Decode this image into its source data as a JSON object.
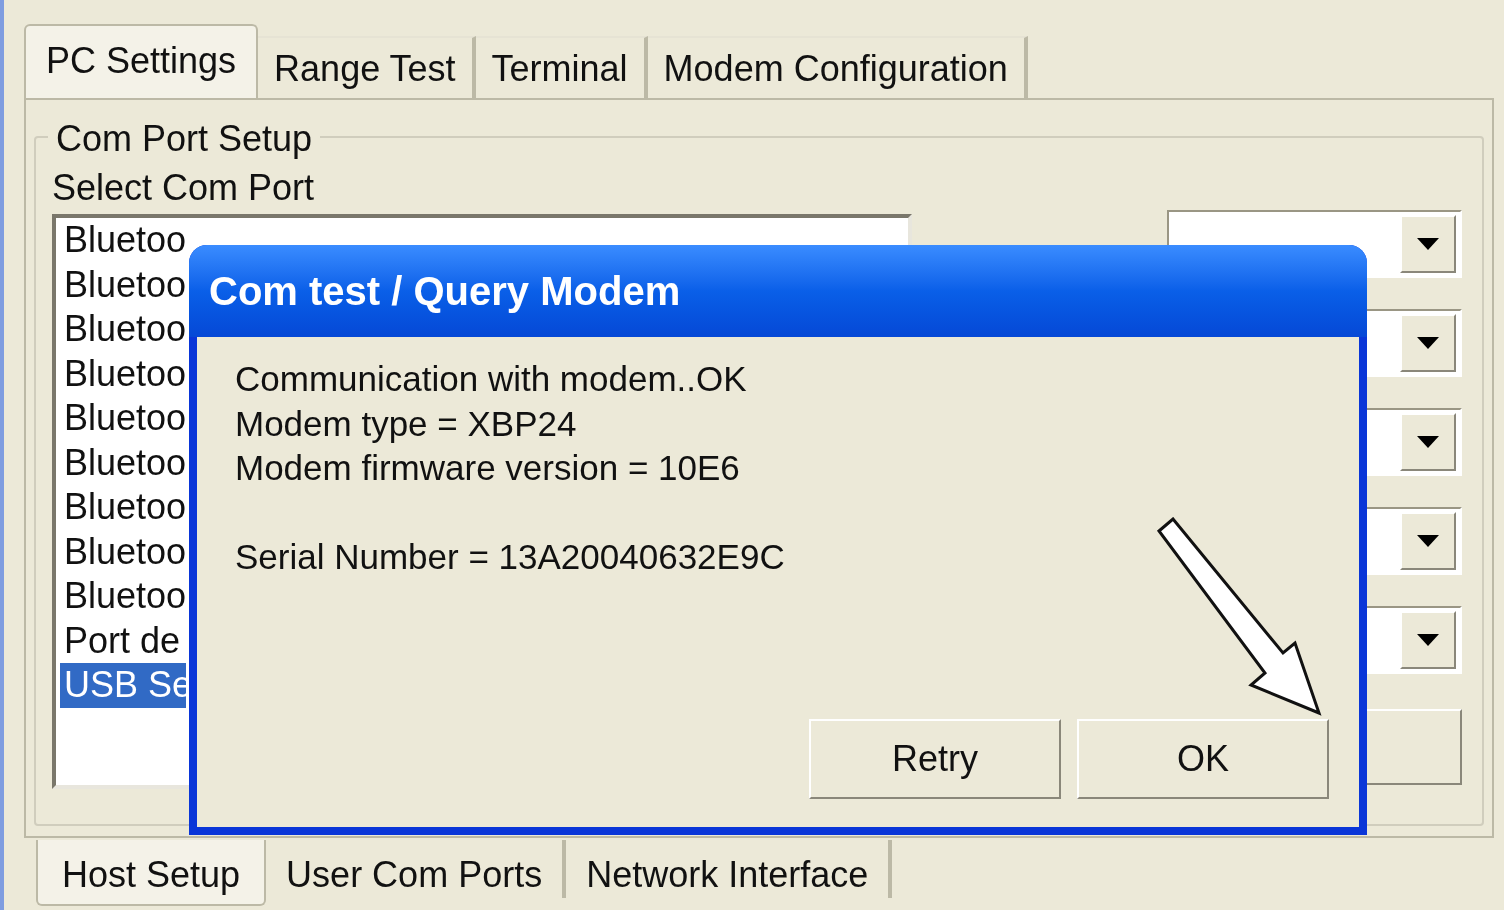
{
  "tabs": [
    {
      "label": "PC Settings",
      "selected": true
    },
    {
      "label": "Range Test",
      "selected": false
    },
    {
      "label": "Terminal",
      "selected": false
    },
    {
      "label": "Modem Configuration",
      "selected": false
    }
  ],
  "com_port_setup": {
    "title": "Com Port Setup",
    "label": "Select Com Port",
    "ports": [
      {
        "text": "Bluetoo",
        "selected": false
      },
      {
        "text": "Bluetoo",
        "selected": false
      },
      {
        "text": "Bluetoo",
        "selected": false
      },
      {
        "text": "Bluetoo",
        "selected": false
      },
      {
        "text": "Bluetoo",
        "selected": false
      },
      {
        "text": "Bluetoo",
        "selected": false
      },
      {
        "text": "Bluetoo",
        "selected": false
      },
      {
        "text": "Bluetoo",
        "selected": false
      },
      {
        "text": "Bluetoo",
        "selected": false
      },
      {
        "text": "Port de",
        "selected": false
      },
      {
        "text": "USB Se",
        "selected": true
      }
    ]
  },
  "dialog": {
    "title": "Com test / Query Modem",
    "paragraphs": [
      [
        "Communication with modem..OK",
        "Modem type = XBP24",
        "Modem firmware version = 10E6"
      ],
      [
        "Serial Number = 13A20040632E9C"
      ]
    ],
    "buttons": [
      "Retry",
      "OK"
    ]
  },
  "bottom_tabs": [
    {
      "label": "Host Setup",
      "selected": true
    },
    {
      "label": "User Com Ports",
      "selected": false
    },
    {
      "label": "Network Interface",
      "selected": false
    }
  ]
}
